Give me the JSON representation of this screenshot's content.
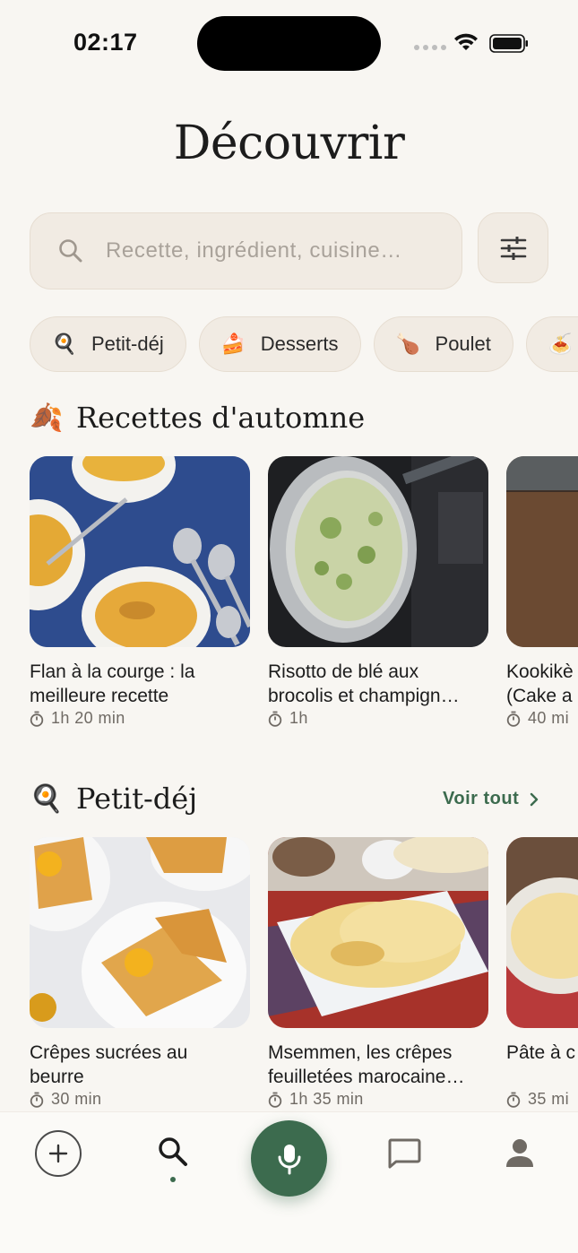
{
  "status": {
    "time": "02:17"
  },
  "title": "Découvrir",
  "search": {
    "placeholder": "Recette, ingrédient, cuisine…"
  },
  "chips": [
    {
      "icon": "🍳",
      "label": "Petit-déj"
    },
    {
      "icon": "🍰",
      "label": "Desserts"
    },
    {
      "icon": "🍗",
      "label": "Poulet"
    },
    {
      "icon": "🍝",
      "label": ""
    }
  ],
  "sections": [
    {
      "emoji": "🍂",
      "title": "Recettes d'automne",
      "see_all": "",
      "cards": [
        {
          "title": "Flan à la courge : la\nmeilleure recette",
          "time": "1h 20 min"
        },
        {
          "title": "Risotto de blé aux\nbrocolis et champign…",
          "time": "1h"
        },
        {
          "title": "Kookikè\n(Cake a",
          "time": "40 mi"
        }
      ]
    },
    {
      "emoji": "🍳",
      "title": "Petit-déj",
      "see_all": "Voir tout",
      "cards": [
        {
          "title": "Crêpes sucrées au\nbeurre",
          "time": "30 min"
        },
        {
          "title": "Msemmen, les crêpes\nfeuilletées marocaine…",
          "time": "1h 35 min"
        },
        {
          "title": "Pâte à c",
          "time": "35 mi"
        }
      ]
    }
  ],
  "colors": {
    "accent": "#3c6b4e",
    "background": "#f8f6f2",
    "chip": "#f1ebe3"
  }
}
